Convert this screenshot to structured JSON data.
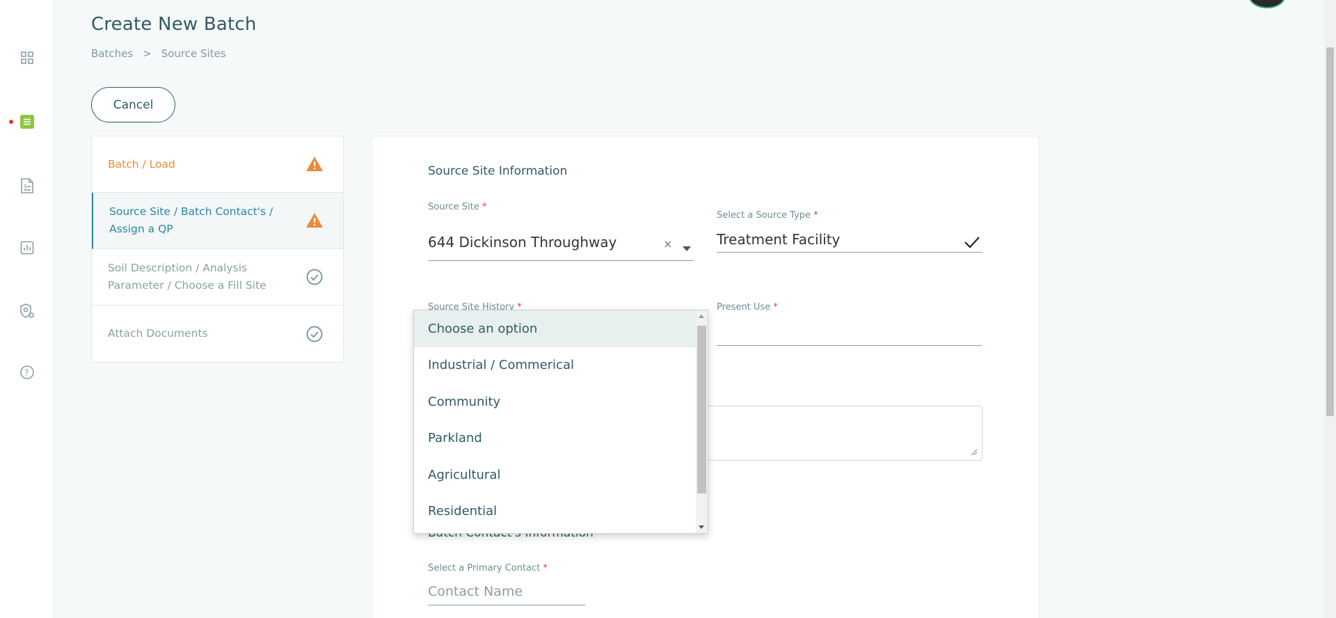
{
  "header": {
    "title": "Create New Batch",
    "breadcrumb": [
      "Batches",
      ">",
      "Source Sites"
    ],
    "cancel_label": "Cancel"
  },
  "rail": {
    "icons": [
      "dashboard-grid-icon",
      "batches-list-icon",
      "invoice-document-icon",
      "reports-chart-icon",
      "settings-shield-icon",
      "help-question-icon"
    ],
    "active_color": "#8dc63f",
    "notification_dot_color": "#e53935"
  },
  "steps": [
    {
      "label": "Batch / Load",
      "status": "warning"
    },
    {
      "label": "Source Site / Batch Contact's / Assign a QP",
      "status": "warning"
    },
    {
      "label": "Soil Description / Analysis Parameter / Choose a Fill Site",
      "status": "complete"
    },
    {
      "label": "Attach Documents",
      "status": "complete"
    }
  ],
  "form": {
    "section_source": "Source Site Information",
    "source_site": {
      "label": "Source Site",
      "required": "*",
      "value": "644 Dickinson Throughway",
      "clear": "×"
    },
    "source_type": {
      "label": "Select a Source Type",
      "required": "*",
      "value": "Treatment Facility"
    },
    "source_history": {
      "label": "Source Site History",
      "required": "*"
    },
    "present_use": {
      "label": "Present Use",
      "required": "*",
      "value": ""
    },
    "section_contact": "Batch Contact's Information",
    "primary_contact": {
      "label": "Select a Primary Contact",
      "required": "*",
      "placeholder": "Contact Name"
    }
  },
  "dropdown": {
    "options": [
      "Choose an option",
      "Industrial / Commerical",
      "Community",
      "Parkland",
      "Agricultural",
      "Residential"
    ],
    "selected_index": 0
  },
  "colors": {
    "warning": "#ef8a3a",
    "active_step": "#2a87a8",
    "complete": "#7f9aa0",
    "primary_text": "#2f5b63"
  }
}
